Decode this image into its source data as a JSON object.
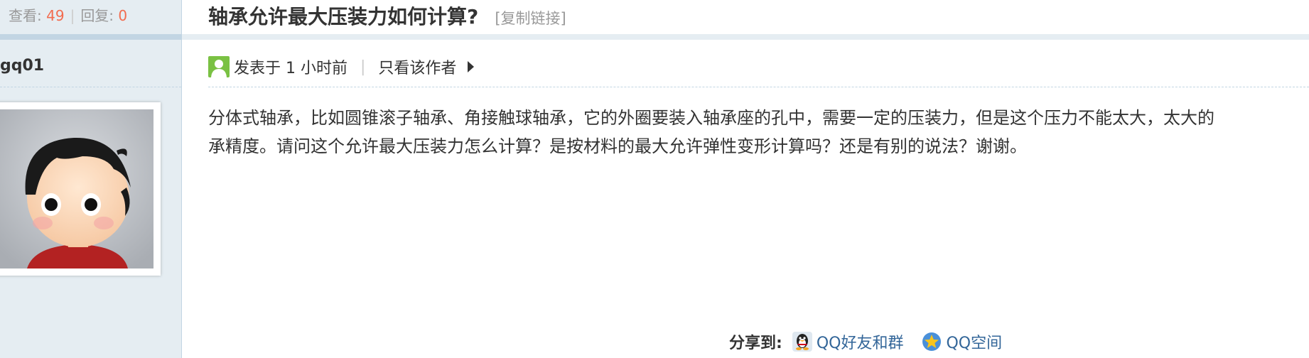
{
  "sidebar": {
    "views_label": "查看:",
    "views_count": "49",
    "replies_label": "回复:",
    "replies_count": "0",
    "separator": "|",
    "username": "gq01"
  },
  "thread": {
    "title": "轴承允许最大压装力如何计算?",
    "copy_link": "[复制链接]"
  },
  "post": {
    "posted_time": "发表于 1 小时前",
    "separator": "|",
    "author_only": "只看该作者",
    "body_line_1": "分体式轴承，比如圆锥滚子轴承、角接触球轴承，它的外圈要装入轴承座的孔中，需要一定的压装力，但是这个压力不能太大，太大的",
    "body_line_2": "承精度。请问这个允许最大压装力怎么计算？是按材料的最大允许弹性变形计算吗？还是有别的说法？谢谢。"
  },
  "share": {
    "label": "分享到:",
    "qq_friends": "QQ好友和群",
    "qq_zone": "QQ空间"
  },
  "colors": {
    "sidebar_bg": "#e5edf2",
    "accent_number": "#f26c4f",
    "link": "#336699",
    "user_icon": "#7ac143"
  },
  "icons": {
    "user": "user-icon",
    "author_arrow": "triangle-right-icon",
    "qq": "qq-penguin-icon",
    "qzone": "qzone-star-icon"
  }
}
